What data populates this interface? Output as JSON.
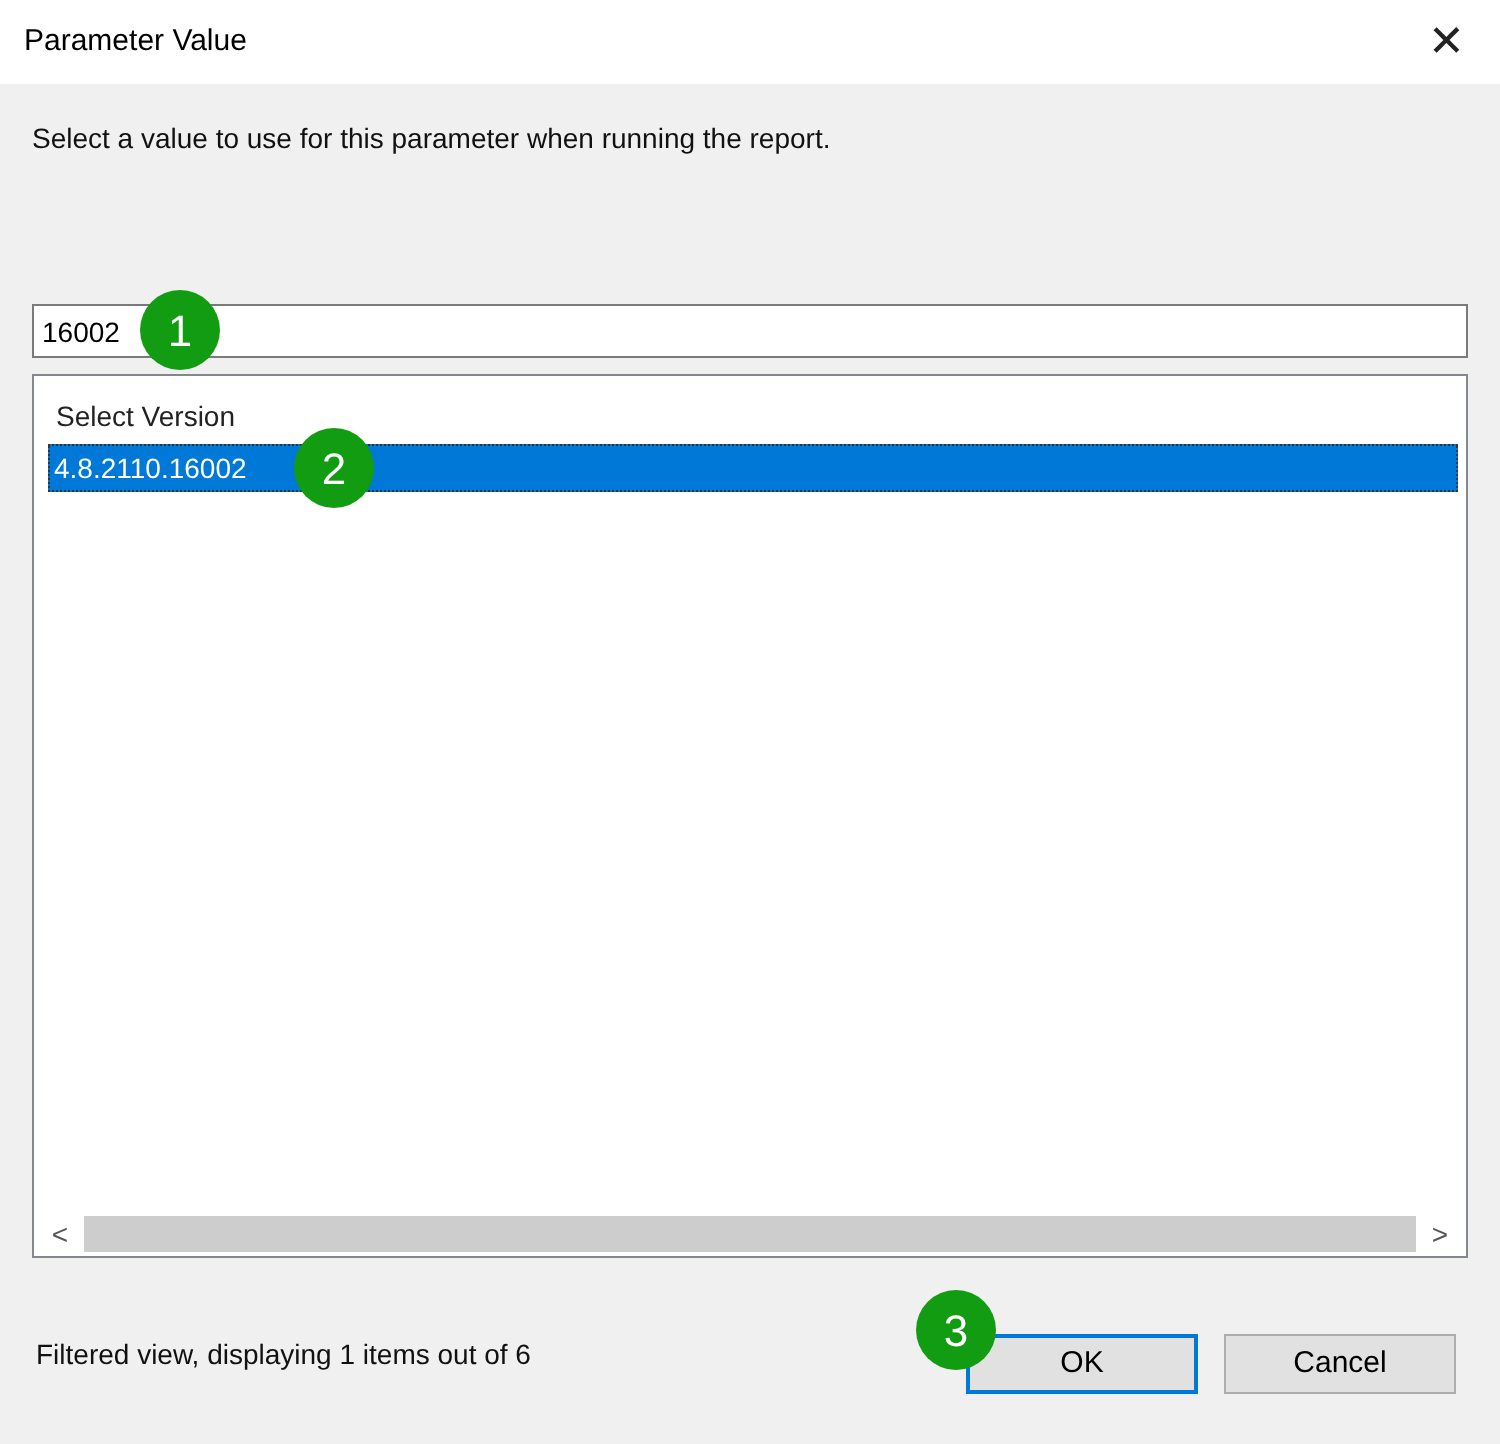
{
  "window": {
    "title": "Parameter Value",
    "close": "✕"
  },
  "instruction": "Select a value to use for this parameter when running the report.",
  "filter_field": {
    "value": "16002",
    "callout": "1"
  },
  "list": {
    "header": "Select Version",
    "items": [
      {
        "label": "4.8.2110.16002",
        "selected": true,
        "callout": "2"
      }
    ]
  },
  "scroll": {
    "left": "<",
    "right": ">"
  },
  "status": "Filtered view, displaying 1 items out of 6",
  "buttons": [
    {
      "label": "OK",
      "default": true,
      "callout": "3"
    },
    {
      "label": "Cancel",
      "default": false
    }
  ]
}
